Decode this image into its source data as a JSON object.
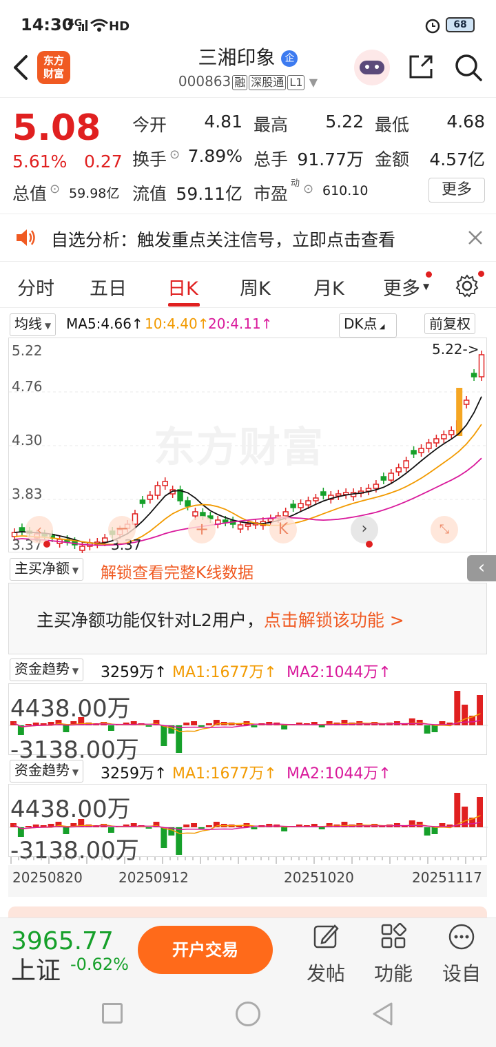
{
  "status": {
    "time": "14:30",
    "signal": "4G",
    "hd": "HD",
    "battery": "68"
  },
  "header": {
    "logo_line1": "东方",
    "logo_line2": "财富",
    "title": "三湘印象",
    "badge": "企",
    "code": "000863",
    "tags": [
      "融",
      "深股通",
      "L1"
    ]
  },
  "quote": {
    "price": "5.08",
    "pct": "5.61%",
    "chg": "0.27",
    "open_label": "今开",
    "open": "4.81",
    "high_label": "最高",
    "high": "5.22",
    "low_label": "最低",
    "low": "4.68",
    "turnover_label": "换手",
    "turnover": "7.89%",
    "volume_label": "总手",
    "volume": "91.77万",
    "amount_label": "金额",
    "amount": "4.57亿",
    "mktcap_label": "总值",
    "mktcap": "59.98亿",
    "float_label": "流值",
    "float": "59.11亿",
    "pe_label": "市盈",
    "pe_sup": "动",
    "pe": "610.10",
    "more": "更多"
  },
  "notice": {
    "text": "自选分析：触发重点关注信号，立即点击查看"
  },
  "tabs": [
    "分时",
    "五日",
    "日K",
    "周K",
    "月K",
    "更多"
  ],
  "active_tab": "日K",
  "kline": {
    "indicator": "均线",
    "ma5": "MA5:4.66↑",
    "ma10": "10:4.40↑",
    "ma20": "20:4.11↑",
    "dk": "DK点",
    "adjust": "前复权",
    "y_labels": [
      "5.22",
      "4.76",
      "4.30",
      "3.83",
      "3.37"
    ],
    "high_marker": "5.22->",
    "low_marker": "3.37",
    "watermark": "东方财富"
  },
  "net_buy": {
    "selector": "主买净额",
    "unlock_link": "解锁查看完整K线数据",
    "msg_plain": "主买净额功能仅针对L2用户，",
    "msg_link": "点击解锁该功能 >"
  },
  "fund1": {
    "selector": "资金趋势",
    "val": "3259万↑",
    "ma1": "MA1:1677万↑",
    "ma2": "MA2:1044万↑",
    "top": "4438.00万",
    "bottom": "-3138.00万"
  },
  "fund2": {
    "selector": "资金趋势",
    "val": "3259万↑",
    "ma1": "MA1:1677万↑",
    "ma2": "MA2:1044万↑",
    "top": "4438.00万",
    "bottom": "-3138.00万"
  },
  "x_dates": [
    "20250820",
    "20250912",
    "20251020",
    "20251117"
  ],
  "bottom": {
    "index_val": "3965.77",
    "index_name": "上证",
    "index_pct": "-0.62%",
    "trade_btn": "开户交易",
    "post": "发帖",
    "func": "功能",
    "custom": "设自"
  },
  "colors": {
    "up": "#e02020",
    "down": "#16a02a",
    "accent": "#ff6a1a",
    "ma5": "#111111",
    "ma10": "#f29a00",
    "ma20": "#d9199b"
  }
}
